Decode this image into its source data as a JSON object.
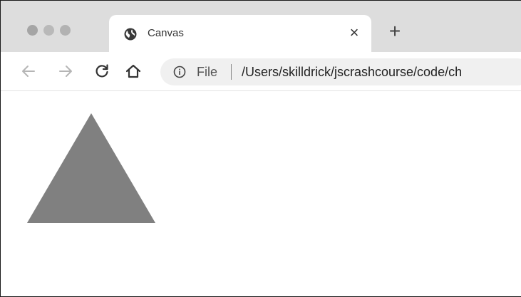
{
  "window": {
    "traffic_lights": [
      "close",
      "minimize",
      "zoom"
    ]
  },
  "tab": {
    "title": "Canvas",
    "favicon": "globe-icon",
    "close_glyph": "×"
  },
  "new_tab": {
    "glyph": "+"
  },
  "toolbar": {
    "back_icon": "arrow-left-icon",
    "forward_icon": "arrow-right-icon",
    "reload_icon": "reload-icon",
    "home_icon": "home-icon"
  },
  "omnibox": {
    "info_icon": "info-icon",
    "scheme_label": "File",
    "url": "/Users/skilldrick/jscrashcourse/code/ch"
  },
  "page": {
    "canvas": {
      "shape": "triangle",
      "fill": "#808080"
    }
  },
  "colors": {
    "tabstrip": "#dddddd",
    "omnibox": "#f0f0f0",
    "triangle": "#808080"
  }
}
